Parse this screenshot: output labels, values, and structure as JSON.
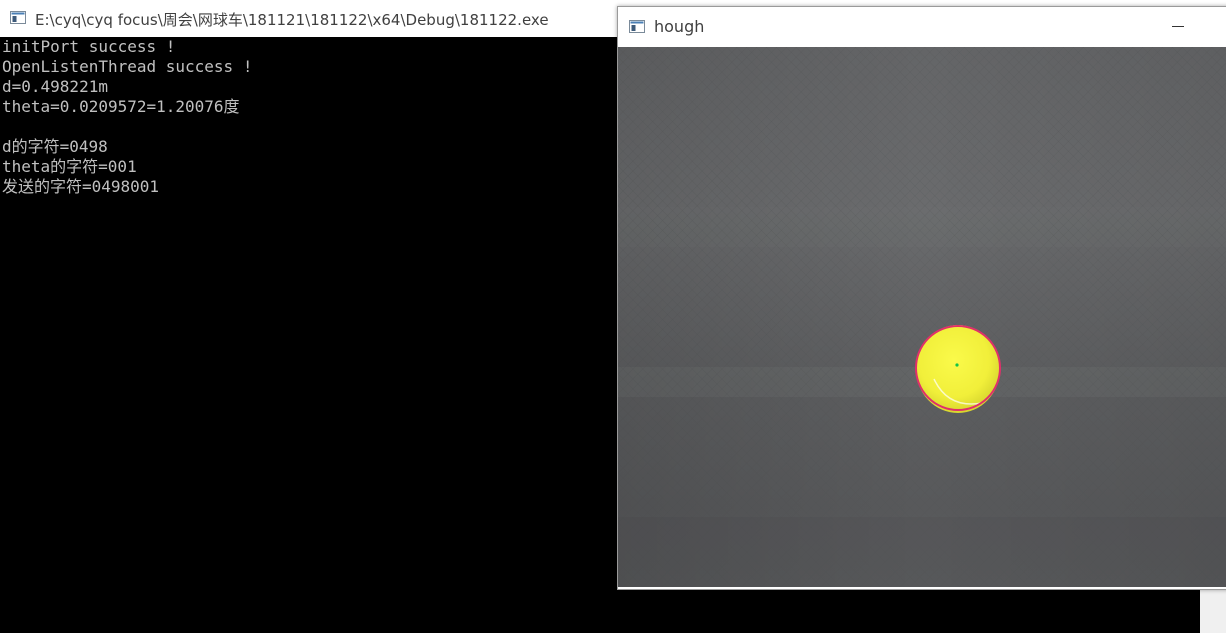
{
  "console": {
    "title": "E:\\cyq\\cyq focus\\周会\\网球车\\181121\\181122\\x64\\Debug\\181122.exe",
    "lines": [
      "initPort success !",
      "OpenListenThread success !",
      "d=0.498221m",
      "theta=0.0209572=1.20076度",
      "",
      "d的字符=0498",
      "theta的字符=001",
      "发送的字符=0498001"
    ]
  },
  "hough": {
    "title": "hough",
    "icon": "window-app-icon",
    "minimize_icon": "minimize-icon",
    "image": {
      "background": "#5d5e60",
      "ball_color": "#f4f23a",
      "circle_color": "#e0306a",
      "center_color": "#13c447"
    }
  }
}
